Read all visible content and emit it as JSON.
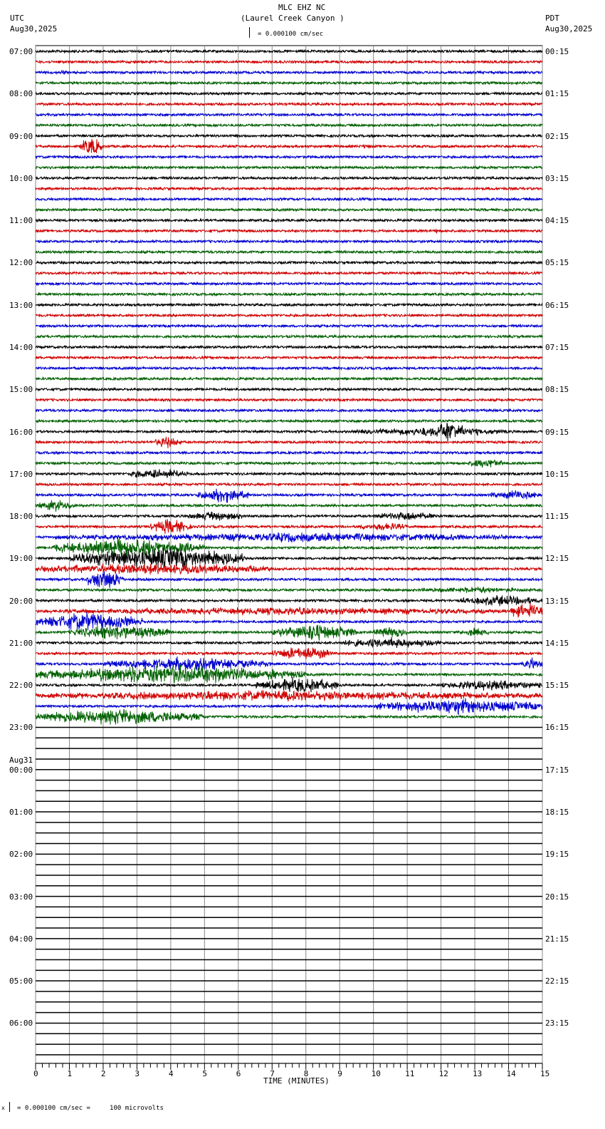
{
  "header": {
    "station": "MLC EHZ NC",
    "location": "(Laurel Creek Canyon )",
    "left_tz": "UTC",
    "left_date": "Aug30,2025",
    "right_tz": "PDT",
    "right_date": "Aug30,2025",
    "scale": "= 0.000100 cm/sec"
  },
  "footer": {
    "scale_note": "= 0.000100 cm/sec =     100 microvolts",
    "mark": "x"
  },
  "chart_data": {
    "type": "line",
    "title": "MLC EHZ NC (Laurel Creek Canyon )",
    "xlabel": "TIME (MINUTES)",
    "xlim": [
      0,
      15
    ],
    "x_ticks": [
      "0",
      "1",
      "2",
      "3",
      "4",
      "5",
      "6",
      "7",
      "8",
      "9",
      "10",
      "11",
      "12",
      "13",
      "14",
      "15"
    ],
    "trace_minutes": 15,
    "trace_colors": [
      "#000000",
      "#d00000",
      "#0000d0",
      "#006000"
    ],
    "traces_with_data": 64,
    "total_traces": 96,
    "utc_labels": [
      "07:00",
      "08:00",
      "09:00",
      "10:00",
      "11:00",
      "12:00",
      "13:00",
      "14:00",
      "15:00",
      "16:00",
      "17:00",
      "18:00",
      "19:00",
      "20:00",
      "21:00",
      "22:00",
      "23:00",
      "00:00",
      "01:00",
      "02:00",
      "03:00",
      "04:00",
      "05:00",
      "06:00"
    ],
    "date_change_label": "Aug31",
    "pdt_labels": [
      "00:15",
      "01:15",
      "02:15",
      "03:15",
      "04:15",
      "05:15",
      "06:15",
      "07:15",
      "08:15",
      "09:15",
      "10:15",
      "11:15",
      "12:15",
      "13:15",
      "14:15",
      "15:15",
      "16:15",
      "17:15",
      "18:15",
      "19:15",
      "20:15",
      "21:15",
      "22:15",
      "23:15"
    ],
    "events": [
      {
        "trace": 2,
        "start": 0.6,
        "end": 1.0,
        "amp": 3
      },
      {
        "trace": 9,
        "start": 1.3,
        "end": 2.0,
        "amp": 12
      },
      {
        "trace": 9,
        "start": 9.5,
        "end": 10.0,
        "amp": 3
      },
      {
        "trace": 17,
        "start": 11.8,
        "end": 12.0,
        "amp": 4
      },
      {
        "trace": 36,
        "start": 9.5,
        "end": 14.2,
        "amp": 6
      },
      {
        "trace": 36,
        "start": 11.8,
        "end": 12.7,
        "amp": 14
      },
      {
        "trace": 37,
        "start": 3.5,
        "end": 4.3,
        "amp": 8
      },
      {
        "trace": 39,
        "start": 12.8,
        "end": 13.8,
        "amp": 7
      },
      {
        "trace": 40,
        "start": 2.7,
        "end": 4.5,
        "amp": 7
      },
      {
        "trace": 42,
        "start": 4.8,
        "end": 6.3,
        "amp": 10
      },
      {
        "trace": 42,
        "start": 13.4,
        "end": 15,
        "amp": 7
      },
      {
        "trace": 43,
        "start": 0,
        "end": 1.2,
        "amp": 7
      },
      {
        "trace": 44,
        "start": 4.5,
        "end": 6.2,
        "amp": 7
      },
      {
        "trace": 44,
        "start": 10,
        "end": 12,
        "amp": 6
      },
      {
        "trace": 45,
        "start": 3.4,
        "end": 4.6,
        "amp": 10
      },
      {
        "trace": 45,
        "start": 9.5,
        "end": 11,
        "amp": 6
      },
      {
        "trace": 46,
        "start": 0.5,
        "end": 15,
        "amp": 6
      },
      {
        "trace": 47,
        "start": 0.5,
        "end": 5,
        "amp": 12
      },
      {
        "trace": 48,
        "start": 1,
        "end": 6.2,
        "amp": 14
      },
      {
        "trace": 49,
        "start": 0,
        "end": 7,
        "amp": 8
      },
      {
        "trace": 50,
        "start": 1.5,
        "end": 2.6,
        "amp": 14
      },
      {
        "trace": 51,
        "start": 11,
        "end": 15,
        "amp": 4
      },
      {
        "trace": 52,
        "start": 12.5,
        "end": 15,
        "amp": 7
      },
      {
        "trace": 53,
        "start": 0,
        "end": 15,
        "amp": 5
      },
      {
        "trace": 53,
        "start": 14,
        "end": 15,
        "amp": 12
      },
      {
        "trace": 54,
        "start": 0,
        "end": 3.2,
        "amp": 12
      },
      {
        "trace": 55,
        "start": 1,
        "end": 4,
        "amp": 10
      },
      {
        "trace": 55,
        "start": 7,
        "end": 9.5,
        "amp": 10
      },
      {
        "trace": 55,
        "start": 10,
        "end": 11,
        "amp": 8
      },
      {
        "trace": 55,
        "start": 12.5,
        "end": 13.5,
        "amp": 6
      },
      {
        "trace": 56,
        "start": 9,
        "end": 12,
        "amp": 7
      },
      {
        "trace": 57,
        "start": 7,
        "end": 8.8,
        "amp": 10
      },
      {
        "trace": 58,
        "start": 2,
        "end": 7,
        "amp": 9
      },
      {
        "trace": 58,
        "start": 14.4,
        "end": 15,
        "amp": 8
      },
      {
        "trace": 59,
        "start": 0,
        "end": 8,
        "amp": 12
      },
      {
        "trace": 60,
        "start": 6.5,
        "end": 9,
        "amp": 10
      },
      {
        "trace": 60,
        "start": 12,
        "end": 15,
        "amp": 7
      },
      {
        "trace": 61,
        "start": 0,
        "end": 15,
        "amp": 7
      },
      {
        "trace": 62,
        "start": 10,
        "end": 15,
        "amp": 10
      },
      {
        "trace": 63,
        "start": 0,
        "end": 5,
        "amp": 10
      }
    ]
  }
}
